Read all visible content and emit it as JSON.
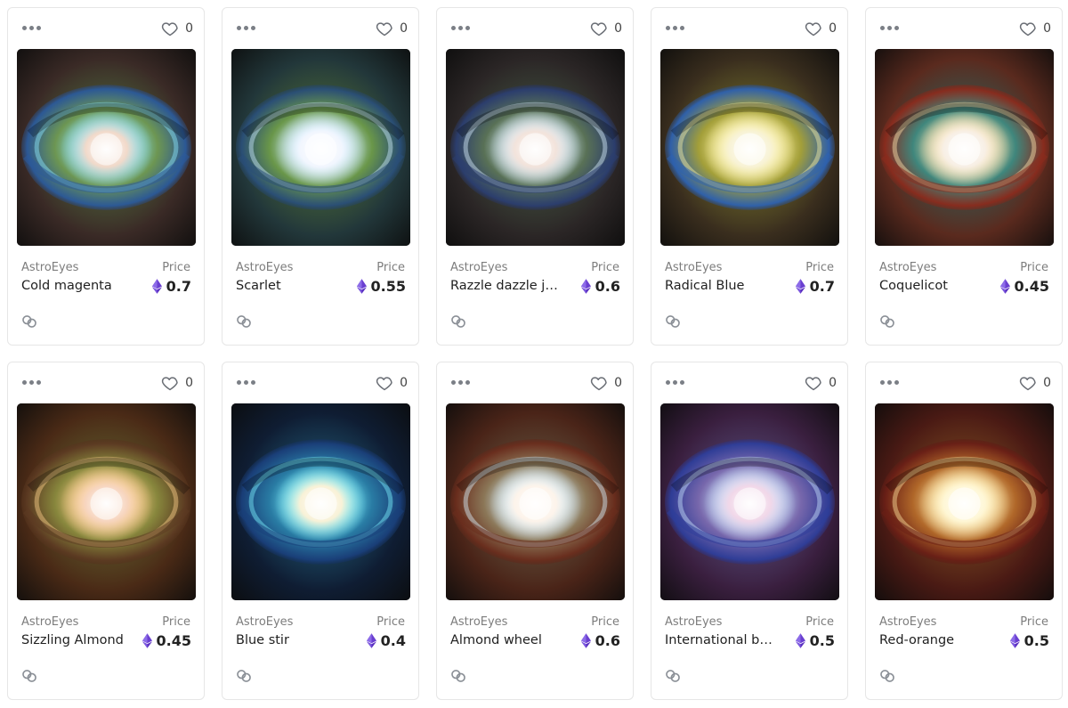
{
  "cards": [
    {
      "collection": "AstroEyes",
      "price_label": "Price",
      "title": "Cold magenta",
      "price": "0.7",
      "likes": "0",
      "palette": {
        "bg": "#3a2a26",
        "iris": "#6f9a54",
        "glow": "#8ee8ff",
        "core": "#f6d9c8",
        "rim": "#2b5a9a"
      }
    },
    {
      "collection": "AstroEyes",
      "price_label": "Price",
      "title": "Scarlet",
      "price": "0.55",
      "likes": "0",
      "palette": {
        "bg": "#22373a",
        "iris": "#6c9a4a",
        "glow": "#cfeeff",
        "core": "#f4f7ff",
        "rim": "#2a4f78"
      }
    },
    {
      "collection": "AstroEyes",
      "price_label": "Price",
      "title": "Razzle dazzle je...",
      "price": "0.6",
      "likes": "0",
      "palette": {
        "bg": "#2b2626",
        "iris": "#5b7458",
        "glow": "#d9f0ff",
        "core": "#f4e3da",
        "rim": "#2b3e70"
      }
    },
    {
      "collection": "AstroEyes",
      "price_label": "Price",
      "title": "Radical Blue",
      "price": "0.7",
      "likes": "0",
      "palette": {
        "bg": "#3a2e1e",
        "iris": "#a7a33a",
        "glow": "#fff4a0",
        "core": "#f8f3d8",
        "rim": "#2e62b0"
      }
    },
    {
      "collection": "AstroEyes",
      "price_label": "Price",
      "title": "Coquelicot",
      "price": "0.45",
      "likes": "0",
      "palette": {
        "bg": "#5a2a1e",
        "iris": "#3f8a80",
        "glow": "#ffe6b0",
        "core": "#f8f0e8",
        "rim": "#8a2b1d"
      }
    },
    {
      "collection": "AstroEyes",
      "price_label": "Price",
      "title": "Sizzling Almond",
      "price": "0.45",
      "likes": "0",
      "palette": {
        "bg": "#4a2a16",
        "iris": "#8a8a3e",
        "glow": "#ffd18c",
        "core": "#f7d6c2",
        "rim": "#5c3a22"
      }
    },
    {
      "collection": "AstroEyes",
      "price_label": "Price",
      "title": "Blue stir",
      "price": "0.4",
      "likes": "0",
      "palette": {
        "bg": "#0f1d33",
        "iris": "#2a7fa8",
        "glow": "#7cf3ff",
        "core": "#fff2d6",
        "rim": "#1a3f7a"
      }
    },
    {
      "collection": "AstroEyes",
      "price_label": "Price",
      "title": "Almond wheel",
      "price": "0.6",
      "likes": "0",
      "palette": {
        "bg": "#4a2418",
        "iris": "#8e7a5a",
        "glow": "#d9f2ff",
        "core": "#fff4ea",
        "rim": "#6a2d1d"
      }
    },
    {
      "collection": "AstroEyes",
      "price_label": "Price",
      "title": "International bl...",
      "price": "0.5",
      "likes": "0",
      "palette": {
        "bg": "#3a1f3f",
        "iris": "#7a6ab0",
        "glow": "#cce6ff",
        "core": "#f3d7e8",
        "rim": "#2e3e9a"
      }
    },
    {
      "collection": "AstroEyes",
      "price_label": "Price",
      "title": "Red-orange",
      "price": "0.5",
      "likes": "0",
      "palette": {
        "bg": "#4a1a14",
        "iris": "#b46a2a",
        "glow": "#ffe4a0",
        "core": "#fff8d8",
        "rim": "#6a1f16"
      }
    }
  ],
  "icons": {
    "menu": "more-dots-icon",
    "like": "heart-icon",
    "currency": "ethereum-icon",
    "chain": "chain-link-icon"
  },
  "colors": {
    "border": "#e6e6e6",
    "muted": "#7d7d7d",
    "eth": "#6a3fd0"
  }
}
